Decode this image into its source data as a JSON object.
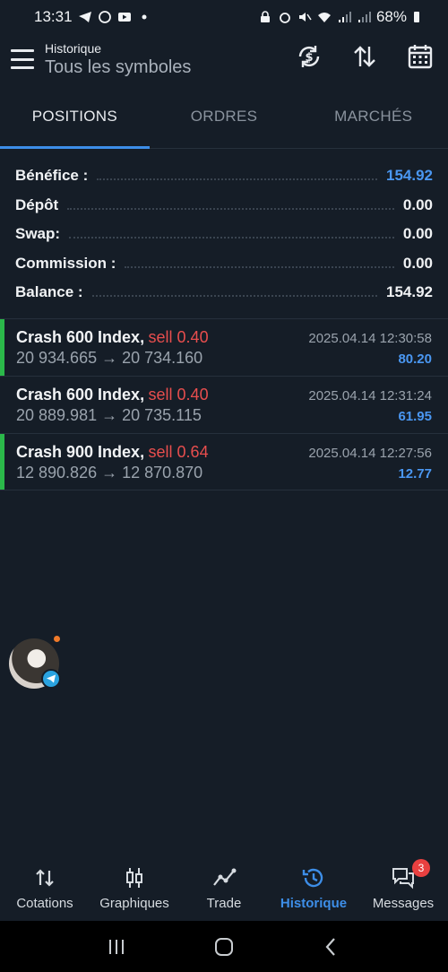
{
  "status_bar": {
    "time": "13:31",
    "battery": "68%",
    "left_icons": [
      "telegram-icon",
      "whatsapp-icon",
      "youtube-icon",
      "dot-icon"
    ],
    "right_icons": [
      "lock-icon",
      "alarm-icon",
      "mute-icon",
      "wifi-icon",
      "signal-icon",
      "signal-icon",
      "battery-icon"
    ]
  },
  "header": {
    "title": "Historique",
    "subtitle": "Tous les symboles",
    "actions": [
      "currency-refresh-icon",
      "sort-icon",
      "calendar-icon"
    ]
  },
  "tabs": [
    {
      "label": "POSITIONS",
      "active": true
    },
    {
      "label": "ORDRES",
      "active": false
    },
    {
      "label": "MARCHÉS",
      "active": false
    }
  ],
  "summary": [
    {
      "label": "Bénéfice :",
      "value": "154.92"
    },
    {
      "label": "Dépôt",
      "value": "0.00"
    },
    {
      "label": "Swap:",
      "value": "0.00"
    },
    {
      "label": "Commission :",
      "value": "0.00"
    },
    {
      "label": "Balance :",
      "value": "154.92"
    }
  ],
  "trades": [
    {
      "symbol": "Crash 600 Index,",
      "type": "sell 0.40",
      "time": "2025.04.14 12:30:58",
      "prices": "20 934.665 → 20 734.160",
      "profit": "80.20"
    },
    {
      "symbol": "Crash 600 Index,",
      "type": "sell 0.40",
      "time": "2025.04.14 12:31:24",
      "prices": "20 889.981 → 20 735.115",
      "profit": "61.95"
    },
    {
      "symbol": "Crash 900 Index,",
      "type": "sell 0.64",
      "time": "2025.04.14 12:27:56",
      "prices": "12 890.826 → 12 870.870",
      "profit": "12.77"
    }
  ],
  "bottom_nav": [
    {
      "label": "Cotations",
      "icon": "quotes-icon",
      "active": false
    },
    {
      "label": "Graphiques",
      "icon": "candles-icon",
      "active": false
    },
    {
      "label": "Trade",
      "icon": "trade-icon",
      "active": false
    },
    {
      "label": "Historique",
      "icon": "history-icon",
      "active": true
    },
    {
      "label": "Messages",
      "icon": "messages-icon",
      "active": false,
      "badge": "3"
    }
  ],
  "colors": {
    "background": "#151d27",
    "accent": "#3d8ee8",
    "profit": "#4a97f2",
    "sell": "#e84e4e",
    "position_bar": "#2bb84a"
  }
}
